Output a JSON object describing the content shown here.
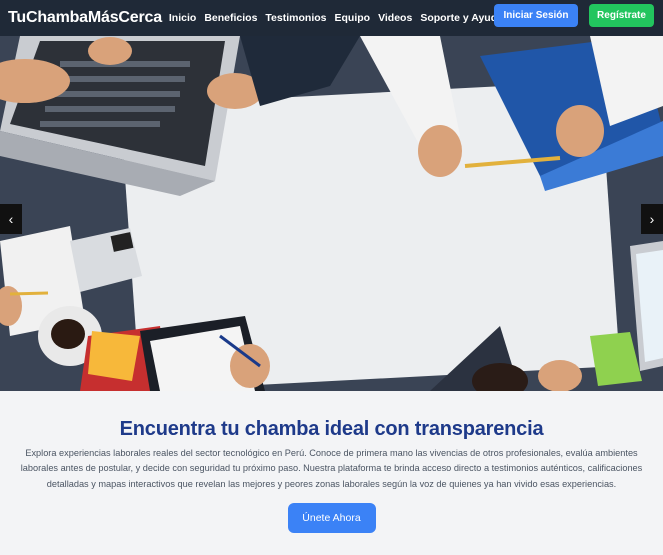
{
  "nav": {
    "brand": "TuChambaMásCerca",
    "links": [
      "Inicio",
      "Beneficios",
      "Testimonios",
      "Equipo",
      "Videos",
      "Soporte y Ayuda"
    ],
    "login_label": "Iniciar Sesión",
    "register_label": "Regístrate"
  },
  "hero": {
    "prev_symbol": "‹",
    "next_symbol": "›"
  },
  "main": {
    "headline": "Encuentra tu chamba ideal con transparencia",
    "description": "Explora experiencias laborales reales del sector tecnológico en Perú. Conoce de primera mano las vivencias de otros profesionales, evalúa ambientes laborales antes de postular, y decide con seguridad tu próximo paso. Nuestra plataforma te brinda acceso directo a testimonios auténticos, calificaciones detalladas y mapas interactivos que revelan las mejores y peores zonas laborales según la voz de quienes ya han vivido esas experiencias.",
    "cta_label": "Únete Ahora"
  },
  "colors": {
    "navbar": "#1f2937",
    "login_button": "#3b82f6",
    "register_button": "#22c55e",
    "headline": "#1e3a8a",
    "cta_button": "#3b82f6"
  }
}
